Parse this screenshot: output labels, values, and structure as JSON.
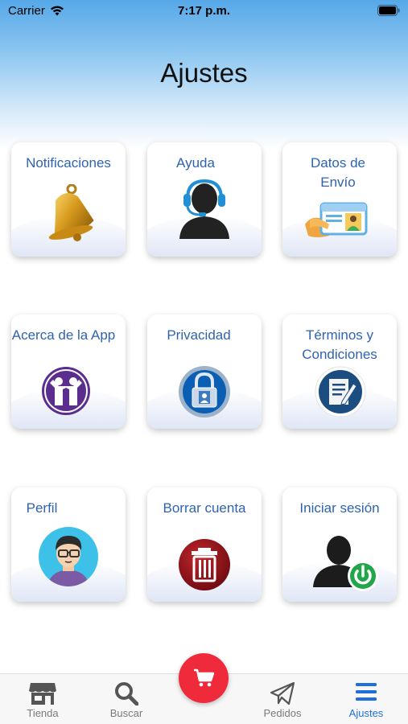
{
  "status_bar": {
    "carrier": "Carrier",
    "time": "7:17 p.m."
  },
  "page": {
    "title": "Ajustes"
  },
  "cards": [
    {
      "label": "Notificaciones",
      "icon": "bell-icon"
    },
    {
      "label": "Ayuda",
      "icon": "support-agent-icon"
    },
    {
      "label": "Datos de Envío",
      "icon": "id-card-icon"
    },
    {
      "label": "Acerca de la App",
      "icon": "about-people-icon"
    },
    {
      "label": "Privacidad",
      "icon": "lock-icon"
    },
    {
      "label": "Términos y Condiciones",
      "icon": "document-icon"
    },
    {
      "label": "Perfil",
      "icon": "profile-avatar-icon"
    },
    {
      "label": "Borrar cuenta",
      "icon": "trash-icon"
    },
    {
      "label": "Iniciar sesión",
      "icon": "login-power-icon"
    }
  ],
  "tab_bar": {
    "tabs": [
      {
        "label": "Tienda",
        "icon": "store-icon"
      },
      {
        "label": "Buscar",
        "icon": "search-icon"
      },
      {
        "label": "Pedidos",
        "icon": "paper-plane-icon"
      },
      {
        "label": "Ajustes",
        "icon": "menu-icon",
        "active": true
      }
    ],
    "center_button_icon": "cart-icon"
  },
  "colors": {
    "accent": "#1f6fd8",
    "card_text": "#2f63b0",
    "cart_button": "#ef2b3b"
  }
}
